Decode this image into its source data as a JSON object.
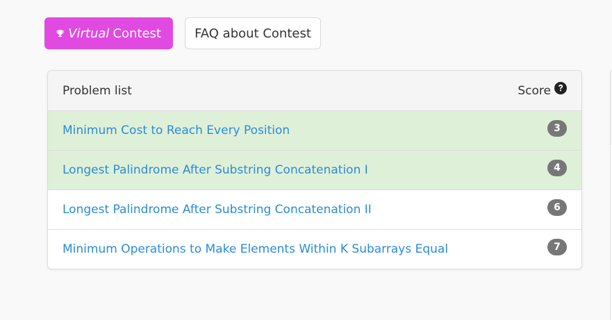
{
  "buttons": {
    "virtual_em": "Virtual",
    "virtual_rest": "Contest",
    "faq": "FAQ about Contest"
  },
  "table": {
    "header_left": "Problem list",
    "header_right": "Score",
    "rows": [
      {
        "title": "Minimum Cost to Reach Every Position",
        "score": "3",
        "solved": true
      },
      {
        "title": "Longest Palindrome After Substring Concatenation I",
        "score": "4",
        "solved": true
      },
      {
        "title": "Longest Palindrome After Substring Concatenation II",
        "score": "6",
        "solved": false
      },
      {
        "title": "Minimum Operations to Make Elements Within K Subarrays Equal",
        "score": "7",
        "solved": false
      }
    ]
  },
  "icons": {
    "virtual_button": "trophy-icon",
    "score_header": "question-circle-icon"
  },
  "colors": {
    "virtual_button_bg": "#e14ae1",
    "solved_row_bg": "#dff0d8",
    "link": "#2a8bd8",
    "badge_bg": "#777777"
  }
}
